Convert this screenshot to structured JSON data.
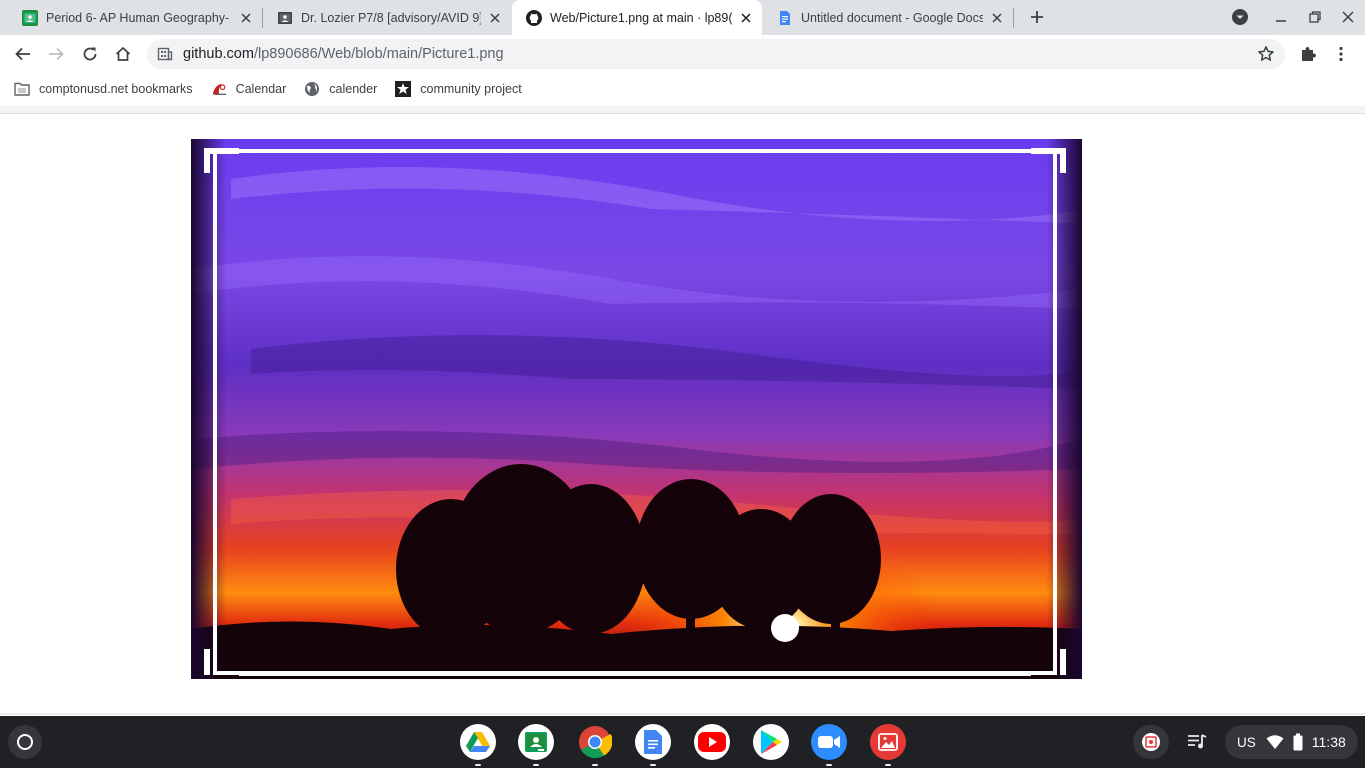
{
  "tabs": [
    {
      "title": "Period 6- AP Human Geography-",
      "favicon": "classroom-icon",
      "active": false
    },
    {
      "title": "Dr. Lozier P7/8 [advisory/AVID 9]",
      "favicon": "classroom-dark-icon",
      "active": false
    },
    {
      "title": "Web/Picture1.png at main · lp89(",
      "favicon": "github-icon",
      "active": true
    },
    {
      "title": "Untitled document - Google Docs",
      "favicon": "docs-icon",
      "active": false
    }
  ],
  "omnibox": {
    "domain": "github.com",
    "path": "/lp890686/Web/blob/main/Picture1.png"
  },
  "bookmarks": [
    {
      "label": "comptonusd.net bookmarks",
      "icon": "folder-icon"
    },
    {
      "label": "Calendar",
      "icon": "calendar-logo-icon"
    },
    {
      "label": "calender",
      "icon": "globe-icon"
    },
    {
      "label": "community project",
      "icon": "puzzle-star-icon"
    }
  ],
  "content": {
    "image_name": "Picture1.png",
    "subject": "purple sunset with tree silhouettes"
  },
  "shelf": {
    "apps": [
      "google-drive",
      "google-classroom",
      "chrome",
      "google-docs",
      "youtube",
      "play-store",
      "zoom",
      "gallery"
    ],
    "ime": "US",
    "clock": "11:38"
  },
  "colors": {
    "tabstrip": "#dee1e6",
    "shelf": "#202124",
    "accent": "#1a73e8"
  }
}
